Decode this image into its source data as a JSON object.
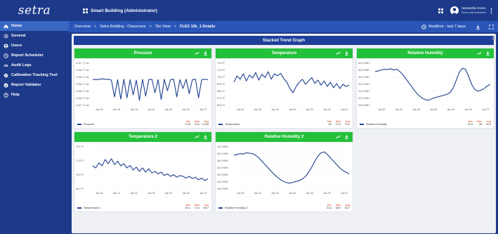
{
  "brand": {
    "logo_text": "setra"
  },
  "sidebar": {
    "items": [
      {
        "label": "Home",
        "icon": "home-icon",
        "active": true
      },
      {
        "label": "General",
        "icon": "gear-icon"
      },
      {
        "label": "Users",
        "icon": "user-icon"
      },
      {
        "label": "Report Scheduler",
        "icon": "clock-icon"
      },
      {
        "label": "Audit Logs",
        "icon": "eye-icon"
      },
      {
        "label": "Calibration Tracking Tool",
        "icon": "tool-icon"
      },
      {
        "label": "Report Validator",
        "icon": "check-icon"
      },
      {
        "label": "Help",
        "icon": "help-icon"
      }
    ]
  },
  "header": {
    "app_title": "Smart Building (Administrator)",
    "user_name": "Samantha Green",
    "user_role": "Demo administrator"
  },
  "breadcrumb": {
    "items": [
      "Overview",
      "Setra Building - Classroom",
      "Tile View",
      "FLEX 10k_1 Details"
    ],
    "separator": ">",
    "range": "Realtime - last 7 days"
  },
  "main": {
    "banner": "Stacked Trend Graph"
  },
  "colors": {
    "tile_header": "#23c03a",
    "line": "#1f3f8f",
    "nav_bg": "#1d3a8a",
    "crumb_bg": "#2a56b8",
    "stat_label": "#e0431f"
  },
  "chart_data": [
    {
      "type": "line",
      "title": "Pressure",
      "y_ticks": [
        "0.017 ?? wc",
        "0.000 ?? wc",
        "0.000 ?? wc",
        "0.000 ?? wc",
        "0.000 ?? wc",
        "0.000 ?? wc",
        "0.017 ?? wc"
      ],
      "x_ticks": [
        "Jan 20",
        "Jan 20",
        "Jan 20",
        "Jan 20",
        "Jan 20",
        "Jan 20",
        "Jan 27"
      ],
      "legend": "Pressure",
      "stats": {
        "labels": [
          "Min",
          "Max",
          "Avg"
        ],
        "values": [
          "0.00",
          "0.00",
          "0.000"
        ]
      },
      "series": [
        {
          "values": [
            0.62,
            0.61,
            0.62,
            0.63,
            0.62,
            0.62,
            0.6,
            0.2,
            0.61,
            0.15,
            0.62,
            0.18,
            0.61,
            0.25,
            0.6,
            0.12,
            0.62,
            0.22,
            0.61,
            0.62,
            0.3,
            0.61,
            0.14,
            0.62,
            0.35,
            0.61,
            0.62,
            0.2,
            0.61,
            0.4,
            0.62,
            0.28,
            0.61,
            0.62,
            0.18,
            0.61,
            0.62,
            0.61
          ]
        }
      ]
    },
    {
      "type": "line",
      "title": "Temperature",
      "y_ticks": [
        "72.8 °F",
        "71.8 °F",
        "70.8 °F",
        "69.8 °F",
        "68.8 °F",
        "67.8 °F",
        "66.8 °F"
      ],
      "x_ticks": [
        "Jan 20",
        "Jan 20",
        "Jan 20",
        "Jan 20",
        "Jan 20",
        "Jan 20",
        "Jan 27"
      ],
      "legend": "Temperature",
      "stats": {
        "labels": [
          "Min",
          "Max",
          "Avg"
        ],
        "values": [
          "69",
          "71.9",
          "70.4"
        ]
      },
      "series": [
        {
          "values": [
            0.55,
            0.7,
            0.62,
            0.75,
            0.58,
            0.72,
            0.65,
            0.78,
            0.6,
            0.74,
            0.66,
            0.8,
            0.62,
            0.75,
            0.7,
            0.76,
            0.64,
            0.55,
            0.4,
            0.3,
            0.45,
            0.55,
            0.62,
            0.5,
            0.58,
            0.66,
            0.52,
            0.6,
            0.48,
            0.58,
            0.45,
            0.55,
            0.42,
            0.52,
            0.4,
            0.5,
            0.45,
            0.48
          ]
        }
      ]
    },
    {
      "type": "line",
      "title": "Relative Humidity",
      "y_ticks": [
        "40.0 %RH",
        "38.0 %RH",
        "36.0 %RH",
        "34.0 %RH",
        "32.0 %RH",
        "30.0 %RH",
        "28.0 %RH"
      ],
      "x_ticks": [
        "Jan 20",
        "Jan 20",
        "Jan 20",
        "Jan 20",
        "Jan 20",
        "Jan 20",
        "Jan 27"
      ],
      "legend": "Relative Humidity",
      "stats": {
        "labels": [
          "Min",
          "Max",
          "Avg"
        ],
        "values": [
          "31.6",
          "38",
          "34.9"
        ]
      },
      "series": [
        {
          "values": [
            0.8,
            0.82,
            0.84,
            0.86,
            0.85,
            0.87,
            0.84,
            0.86,
            0.8,
            0.72,
            0.62,
            0.52,
            0.42,
            0.32,
            0.24,
            0.18,
            0.14,
            0.12,
            0.15,
            0.18,
            0.2,
            0.22,
            0.24,
            0.26,
            0.3,
            0.4,
            0.58,
            0.78,
            0.88,
            0.86,
            0.7,
            0.5,
            0.38,
            0.34,
            0.36,
            0.4,
            0.46,
            0.5
          ]
        }
      ]
    },
    {
      "type": "line",
      "title": "Temperature 2",
      "y_ticks": [
        "73.1 °F",
        "71.8 °F",
        "70.6 °F",
        "69.3 °F"
      ],
      "x_ticks": [
        "Jan 20",
        "Jan 21",
        "Jan 22",
        "Jan 23",
        "Jan 24",
        "Jan 25",
        "Jan 27"
      ],
      "legend": "Temperature 2",
      "stats": {
        "labels": [
          "Min",
          "Max",
          "Avg"
        ],
        "values": [
          "69.1",
          "71.5",
          "69.7"
        ]
      },
      "series": [
        {
          "values": [
            0.55,
            0.5,
            0.62,
            0.55,
            0.7,
            0.6,
            0.72,
            0.58,
            0.66,
            0.55,
            0.6,
            0.5,
            0.56,
            0.45,
            0.52,
            0.42,
            0.5,
            0.4,
            0.48,
            0.38,
            0.42,
            0.36,
            0.4,
            0.32,
            0.36,
            0.3,
            0.34,
            0.28,
            0.32,
            0.3,
            0.26,
            0.3,
            0.25,
            0.28,
            0.22,
            0.26,
            0.2,
            0.24
          ]
        }
      ]
    },
    {
      "type": "line",
      "title": "Relative Humidity 2",
      "y_ticks": [
        "40.0 %RH",
        "38.0 %RH",
        "36.0 %RH",
        "34.0 %RH",
        "32.0 %RH",
        "30.0 %RH",
        "28.0 %RH"
      ],
      "x_ticks": [
        "Jan 20",
        "Jan 20",
        "Jan 20",
        "Jan 20",
        "Jan 20",
        "Jan 20",
        "Jan 27"
      ],
      "legend": "Relative Humidity 2",
      "stats": {
        "labels": [
          "Min",
          "Max",
          "Avg"
        ],
        "values": [
          "31.6",
          "38.9",
          "34.7"
        ]
      },
      "series": [
        {
          "values": [
            0.8,
            0.82,
            0.84,
            0.83,
            0.86,
            0.85,
            0.84,
            0.8,
            0.74,
            0.66,
            0.58,
            0.5,
            0.42,
            0.34,
            0.28,
            0.22,
            0.18,
            0.15,
            0.14,
            0.16,
            0.18,
            0.2,
            0.24,
            0.3,
            0.4,
            0.52,
            0.66,
            0.78,
            0.86,
            0.88,
            0.82,
            0.74,
            0.66,
            0.58,
            0.5,
            0.44,
            0.4,
            0.36
          ]
        }
      ]
    }
  ]
}
